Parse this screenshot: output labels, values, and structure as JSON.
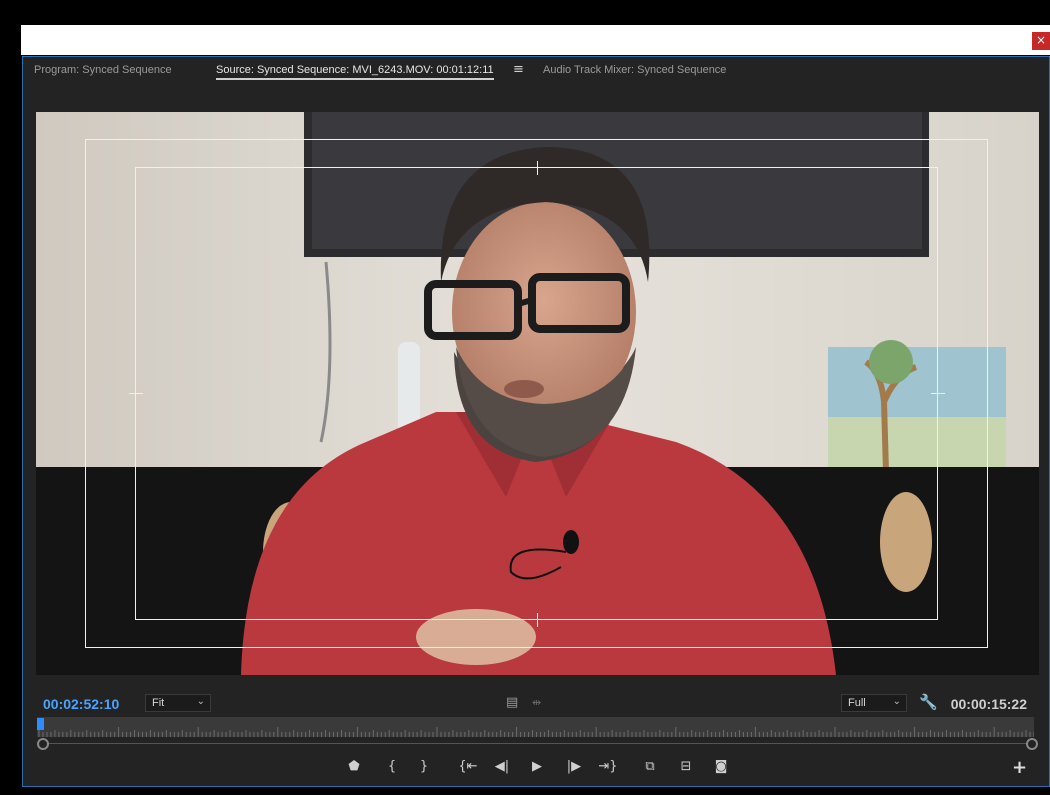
{
  "window": {
    "close_glyph": "×"
  },
  "tabs": [
    {
      "label": "Program: Synced Sequence"
    },
    {
      "label": "Source: Synced Sequence: MVI_6243.MOV: 00:01:12:11"
    },
    {
      "label": "Audio Track Mixer: Synced Sequence"
    }
  ],
  "tab_menu_glyph": "≡",
  "controls": {
    "current_timecode": "00:02:52:10",
    "zoom_value": "Fit",
    "resolution_value": "Full",
    "duration_timecode": "00:00:15:22"
  },
  "timeline": {
    "playhead_position": 0.0
  },
  "transport": [
    {
      "name": "add-marker-button",
      "glyph": "⬟"
    },
    {
      "name": "mark-in-button",
      "glyph": "{"
    },
    {
      "name": "mark-out-button",
      "glyph": "}"
    },
    {
      "name": "go-to-in-button",
      "glyph": "{⇤"
    },
    {
      "name": "step-back-button",
      "glyph": "◀|"
    },
    {
      "name": "play-button",
      "glyph": "▶"
    },
    {
      "name": "step-forward-button",
      "glyph": "|▶"
    },
    {
      "name": "go-to-out-button",
      "glyph": "⇥}"
    },
    {
      "name": "insert-button",
      "glyph": "⧉"
    },
    {
      "name": "overwrite-button",
      "glyph": "⊟"
    },
    {
      "name": "export-frame-button",
      "glyph": "◙"
    }
  ],
  "add_button_glyph": "+",
  "colors": {
    "accent": "#2f8bff",
    "timecode": "#4aa3ff",
    "close": "#c62828",
    "panel_border": "#2e6fb0"
  }
}
